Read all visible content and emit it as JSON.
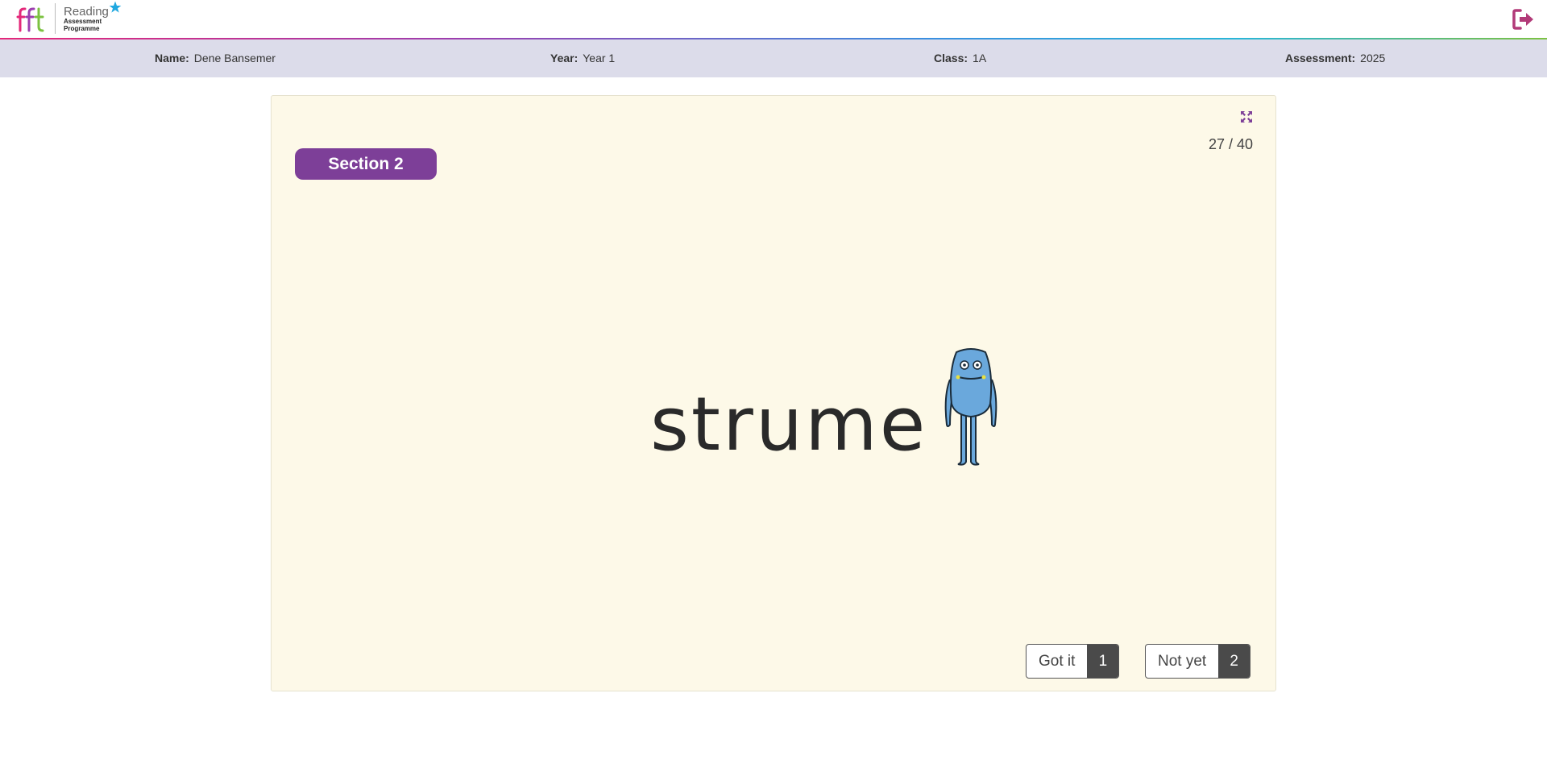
{
  "header": {
    "logo": {
      "brand": "fft",
      "title": "Reading",
      "subtitle_1": "Assessment",
      "subtitle_2": "Programme"
    },
    "logout_icon": "sign-out-icon",
    "colors": {
      "brand_pink": "#e4287a",
      "brand_purple": "#9c3fb0",
      "brand_green": "#7cc242",
      "logout": "#b23a78"
    }
  },
  "student_info": {
    "name_label": "Name:",
    "name_value": "Dene Bansemer",
    "year_label": "Year:",
    "year_value": "Year 1",
    "class_label": "Class:",
    "class_value": "1A",
    "assessment_label": "Assessment:",
    "assessment_value": "2025"
  },
  "card": {
    "expand_icon": "expand-icon",
    "counter": "27 / 40",
    "section_label": "Section 2",
    "word": "strume",
    "image_icon": "alien-creature-icon",
    "buttons": [
      {
        "label": "Got it",
        "key": "1"
      },
      {
        "label": "Not yet",
        "key": "2"
      }
    ],
    "colors": {
      "background": "#fdf9e8",
      "section_badge": "#7d3f98",
      "key_bg": "#4a4a4a",
      "alien_body": "#6aa8dc"
    }
  }
}
